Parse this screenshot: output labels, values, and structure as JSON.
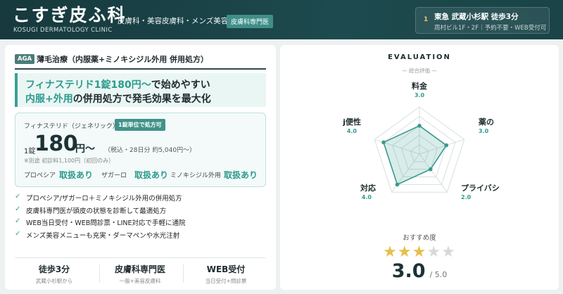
{
  "header": {
    "logo": "こすぎ皮ふ科",
    "logo_sub": "KOSUGI DERMATOLOGY CLINIC",
    "tags": "皮膚科・美容皮膚科・メンズ美容",
    "badge": "皮膚科専門医",
    "access_icon": "1",
    "access_main": "東急 武蔵小杉駅 徒歩3分",
    "access_sub": "周村ビル1F・2F｜予約不要・WEB受付可"
  },
  "treatment": {
    "badge": "AGA",
    "title": "薄毛治療（内服薬+ミノキシジル外用 併用処方）",
    "headline1_accent_a": "フィナステリド",
    "headline1_accent_b": "1錠180円〜",
    "headline1_rest": "で始めやすい",
    "headline2_accent": "内服+外用",
    "headline2_rest": "の併用処方で発毛効果を最大化"
  },
  "price": {
    "drug": "フィナステリド（ジェネリック）",
    "unit_badge": "1錠単位で処方可",
    "prefix": "1錠",
    "amount": "180",
    "yen": "円〜",
    "tax": "（税込・28日分 約5,040円〜）",
    "note": "※別途 初診料1,100円（初回のみ）",
    "availability": [
      {
        "name": "プロペシア",
        "value": "取扱あり"
      },
      {
        "name": "ザガーロ",
        "value": "取扱あり"
      },
      {
        "name": "ミノキシジル外用",
        "value": "取扱あり"
      }
    ]
  },
  "features": [
    "プロペシア/ザガーロ＋ミノキシジル外用の併用処方",
    "皮膚科専門医が頭皮の状態を診断して最適処方",
    "WEB当日受付・WEB問診票・LINE対応で手軽に通院",
    "メンズ美容メニューも充実・ダーマペンや水光注射"
  ],
  "stats": [
    {
      "main": "徒歩3分",
      "sub": "武蔵小杉駅から"
    },
    {
      "main": "皮膚科専門医",
      "sub": "一般+美容皮膚科"
    },
    {
      "main": "WEB受付",
      "sub": "当日受付+問診票"
    }
  ],
  "evaluation": {
    "title": "EVALUATION",
    "subtitle": "— 総合評価 —",
    "recommend_label": "おすすめ度",
    "score": "3.0",
    "score_max": "/ 5.0",
    "stars_filled": 3,
    "stars_total": 5
  },
  "chart_data": {
    "type": "radar",
    "axes": [
      "料金",
      "薬の種類",
      "プライバシー",
      "対応",
      "利便性"
    ],
    "axes_visible_text": [
      "料金",
      "薬の",
      "プライバシ",
      "対応",
      "j便性"
    ],
    "values": [
      3.0,
      3.0,
      2.0,
      4.0,
      4.0
    ],
    "value_labels": [
      "3.0",
      "3.0",
      "2.0",
      "4.0",
      "4.0"
    ],
    "range": [
      0,
      5
    ],
    "rings": 5,
    "colors": {
      "fill": "#4fa79b",
      "stroke": "#3a998d",
      "grid": "#d9dfdf",
      "label_value": "#2d9a8e"
    }
  },
  "colors": {
    "brand_dark": "#16393d",
    "accent": "#2d9a8e",
    "star": "#e5c04a"
  }
}
